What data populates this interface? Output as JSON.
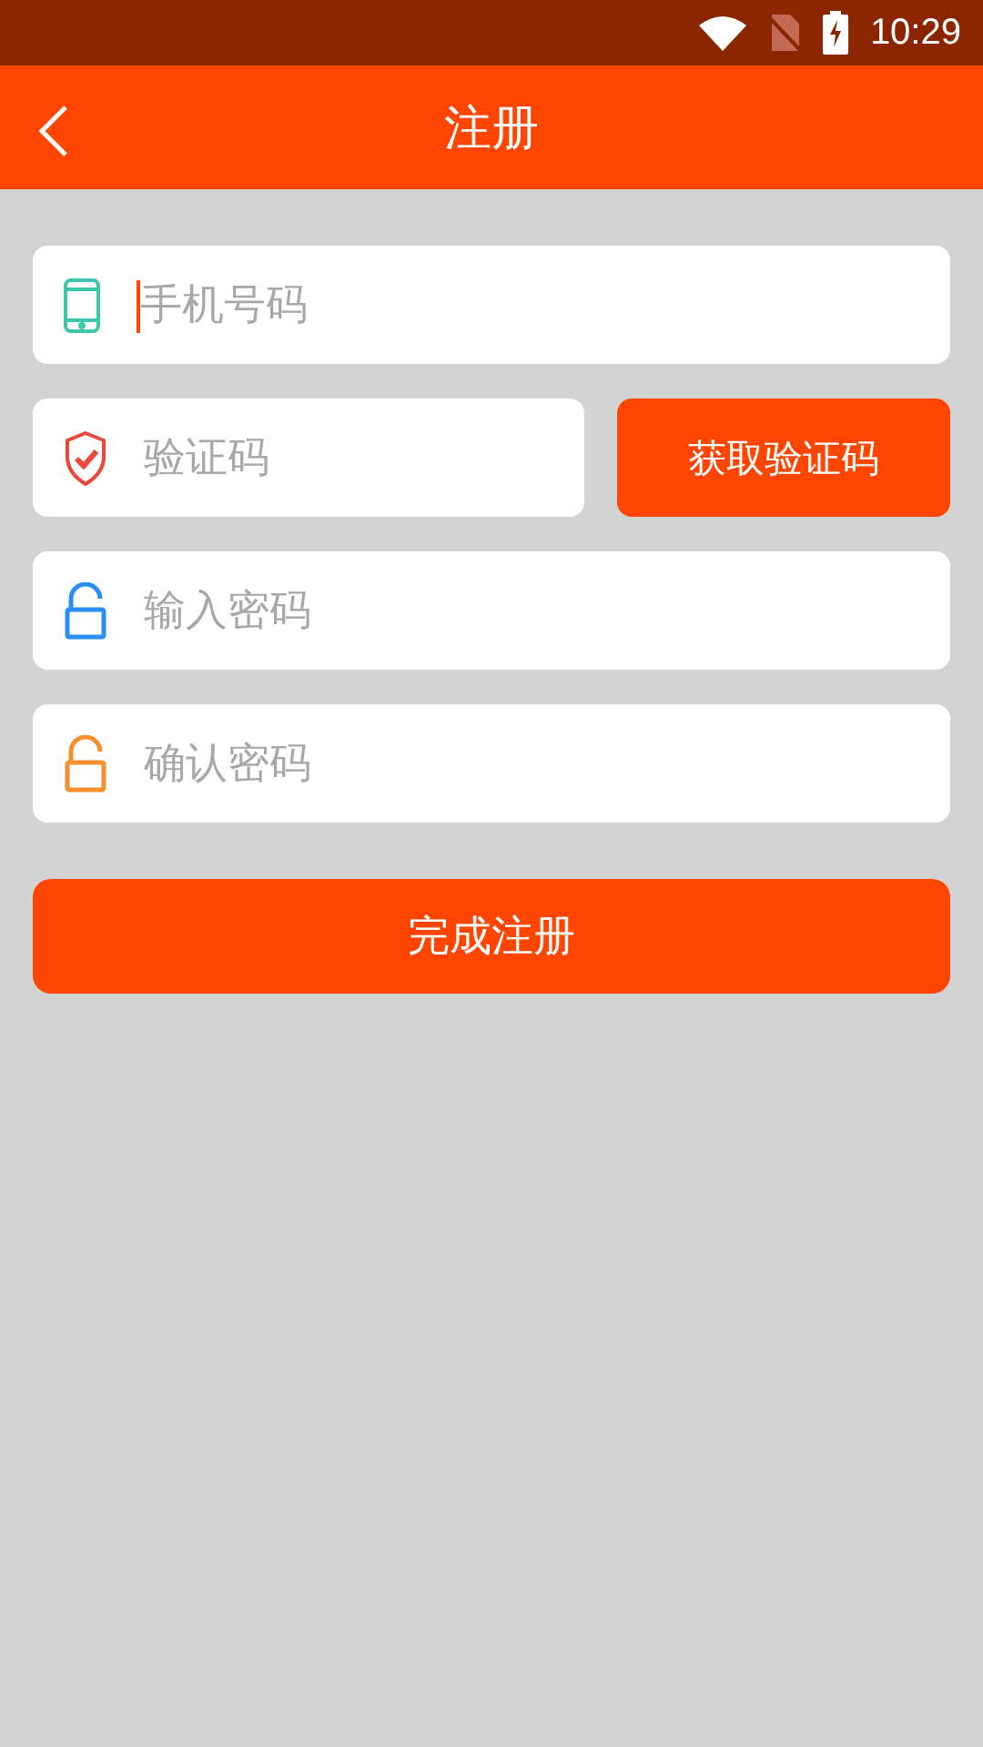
{
  "status_bar": {
    "time": "10:29"
  },
  "header": {
    "title": "注册"
  },
  "fields": [
    {
      "kind": "phone",
      "placeholder": "手机号码",
      "color": "#3cc8a8",
      "focused": true
    },
    {
      "kind": "code",
      "placeholder": "验证码",
      "color": "#e9483a",
      "focused": false
    },
    {
      "kind": "lock",
      "placeholder": "输入密码",
      "color": "#2b8ef5",
      "focused": false
    },
    {
      "kind": "lock",
      "placeholder": "确认密码",
      "color": "#f7902c",
      "focused": false
    }
  ],
  "code_button": "获取验证码",
  "submit_button": "完成注册"
}
